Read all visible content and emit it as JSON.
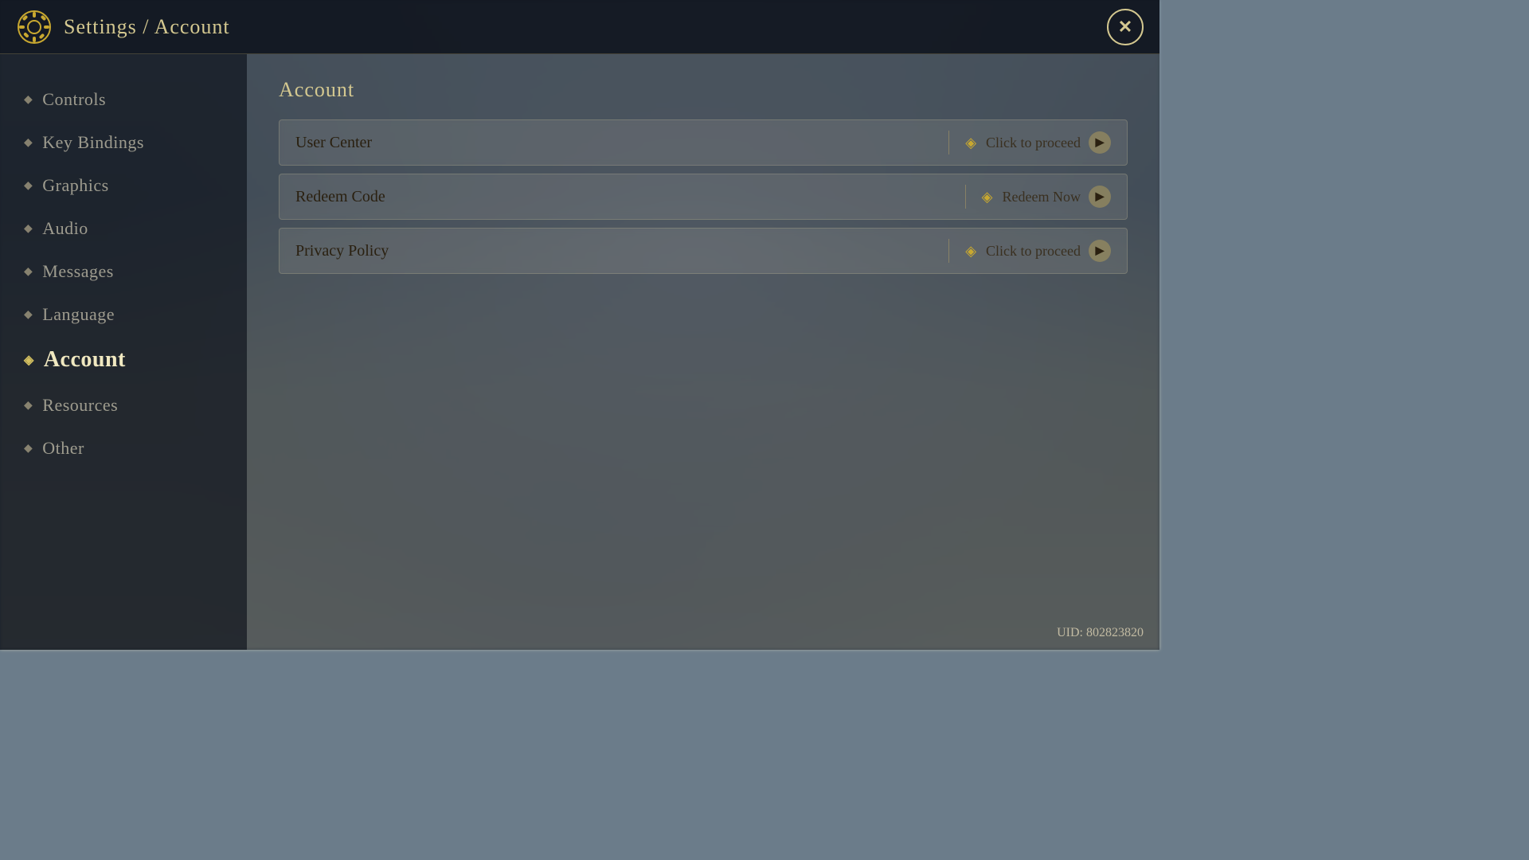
{
  "header": {
    "title": "Settings / Account",
    "close_label": "✕",
    "gear_icon": "⚙"
  },
  "sidebar": {
    "items": [
      {
        "id": "controls",
        "label": "Controls",
        "active": false
      },
      {
        "id": "key-bindings",
        "label": "Key Bindings",
        "active": false
      },
      {
        "id": "graphics",
        "label": "Graphics",
        "active": false
      },
      {
        "id": "audio",
        "label": "Audio",
        "active": false
      },
      {
        "id": "messages",
        "label": "Messages",
        "active": false
      },
      {
        "id": "language",
        "label": "Language",
        "active": false
      },
      {
        "id": "account",
        "label": "Account",
        "active": true
      },
      {
        "id": "resources",
        "label": "Resources",
        "active": false
      },
      {
        "id": "other",
        "label": "Other",
        "active": false
      }
    ]
  },
  "main": {
    "section_title": "Account",
    "actions": [
      {
        "id": "user-center",
        "label": "User Center",
        "cta": "Click to proceed"
      },
      {
        "id": "redeem-code",
        "label": "Redeem Code",
        "cta": "Redeem Now"
      },
      {
        "id": "privacy-policy",
        "label": "Privacy Policy",
        "cta": "Click to proceed"
      }
    ]
  },
  "footer": {
    "uid": "UID: 802823820"
  }
}
